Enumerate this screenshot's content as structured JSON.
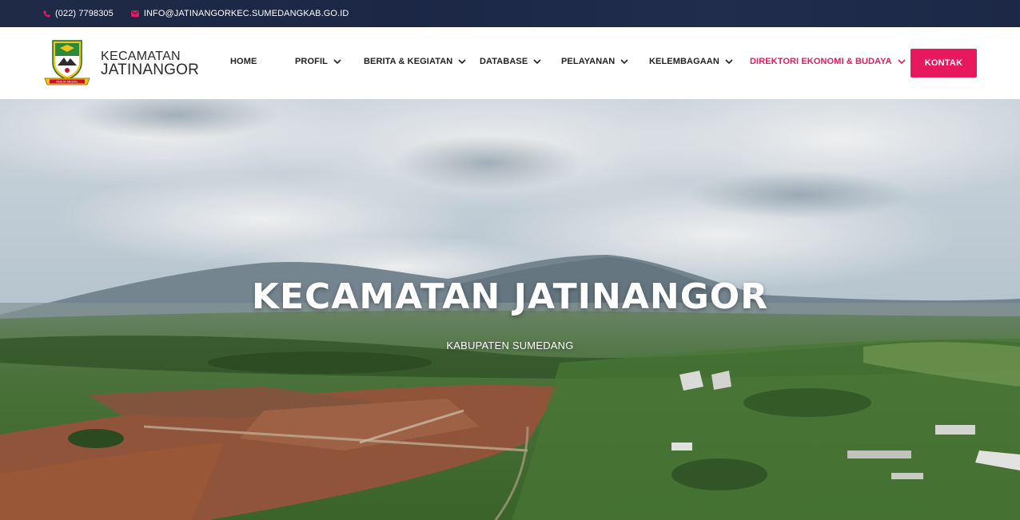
{
  "topbar": {
    "phone": "(022) 7798305",
    "email": "INFO@JATINANGORKEC.SUMEDANGKAB.GO.ID",
    "phone_icon": "phone-icon",
    "email_icon": "envelope-icon"
  },
  "logo": {
    "line1": "KECAMATAN",
    "line2": "JATINANGOR",
    "emblem_icon": "regency-emblem-icon",
    "emblem_motto": "INSUN MEDAL"
  },
  "nav": {
    "items": [
      {
        "label": "HOME",
        "has_dropdown": false
      },
      {
        "label": "PROFIL",
        "has_dropdown": true
      },
      {
        "label": "BERITA & KEGIATAN",
        "has_dropdown": true
      },
      {
        "label": "DATABASE",
        "has_dropdown": true
      },
      {
        "label": "PELAYANAN",
        "has_dropdown": true
      },
      {
        "label": "KELEMBAGAAN",
        "has_dropdown": true
      },
      {
        "label": "DIREKTORI EKONOMI & BUDAYA",
        "has_dropdown": true,
        "active": true
      }
    ],
    "cta_label": "KONTAK"
  },
  "hero": {
    "title": "KECAMATAN JATINANGOR",
    "subtitle": "KABUPATEN SUMEDANG"
  },
  "colors": {
    "accent": "#e8185f",
    "topbar_bg": "#1f2a47",
    "text_dark": "#222222"
  }
}
